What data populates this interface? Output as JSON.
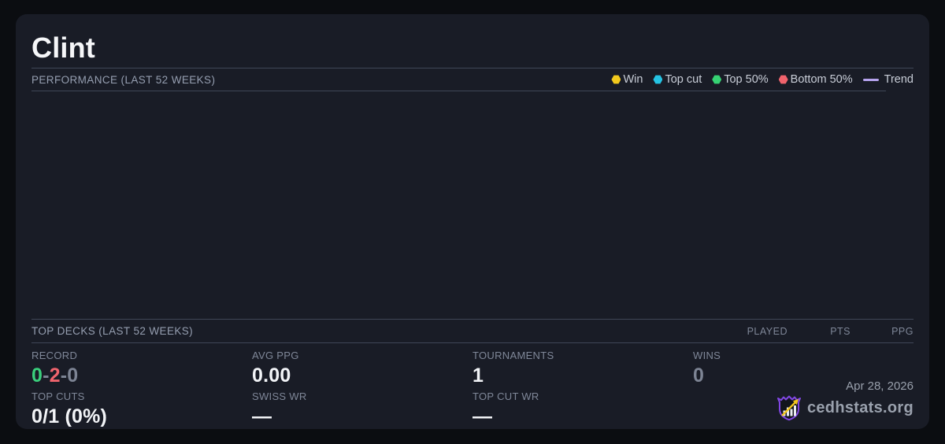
{
  "player": {
    "name": "Clint"
  },
  "performance": {
    "header": "PERFORMANCE (LAST 52 WEEKS)",
    "legend": [
      {
        "label": "Win",
        "color": "#f2c91d",
        "type": "dot",
        "name": "win-legend-dot"
      },
      {
        "label": "Top cut",
        "color": "#25c3e3",
        "type": "dot",
        "name": "top-cut-legend-dot"
      },
      {
        "label": "Top 50%",
        "color": "#36d273",
        "type": "dot",
        "name": "top-50-legend-dot"
      },
      {
        "label": "Bottom 50%",
        "color": "#f0636c",
        "type": "dot",
        "name": "bottom-50-legend-dot"
      },
      {
        "label": "Trend",
        "color": "#b6a3ee",
        "type": "line",
        "name": "trend-legend-line"
      }
    ],
    "chart_empty": true
  },
  "top_decks": {
    "header": "TOP DECKS (LAST 52 WEEKS)",
    "columns": [
      "PLAYED",
      "PTS",
      "PPG"
    ],
    "rows": []
  },
  "stats": {
    "record": {
      "label": "RECORD",
      "wins": "0",
      "losses": "2",
      "draws": "0",
      "separator": "-",
      "win_color": "#3ad07c",
      "loss_color": "#f0646d",
      "draw_color": "#7d8494"
    },
    "avg_ppg": {
      "label": "AVG PPG",
      "value": "0.00"
    },
    "tournaments": {
      "label": "TOURNAMENTS",
      "value": "1"
    },
    "wins": {
      "label": "WINS",
      "value": "0"
    },
    "top_cuts": {
      "label": "TOP CUTS",
      "value": "0/1 (0%)"
    },
    "swiss_wr": {
      "label": "SWISS WR",
      "value": "—"
    },
    "top_cut_wr": {
      "label": "TOP CUT WR",
      "value": "—"
    }
  },
  "footer": {
    "date": "Apr 28, 2026",
    "brand": "cedhstats.org"
  },
  "colors": {
    "page_bg": "#0b0d11",
    "card_bg": "#191c26",
    "divider": "#3f4657",
    "logo_purple": "#8247e5",
    "logo_gold": "#f2c61d"
  }
}
